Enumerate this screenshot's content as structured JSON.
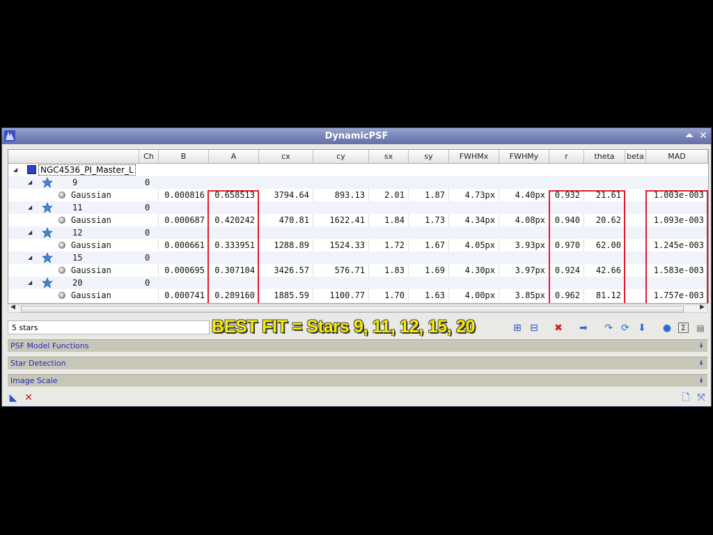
{
  "window": {
    "title": "DynamicPSF"
  },
  "table": {
    "columns": [
      "",
      "Ch",
      "B",
      "A",
      "cx",
      "cy",
      "sx",
      "sy",
      "FWHMx",
      "FWHMy",
      "r",
      "theta",
      "beta",
      "MAD"
    ],
    "root_label": "NGC4536_PI_Master_L",
    "stars": [
      {
        "id": "9",
        "ch": "0",
        "fn": "Gaussian",
        "B": "0.000816",
        "A": "0.658513",
        "cx": "3794.64",
        "cy": "893.13",
        "sx": "2.01",
        "sy": "1.87",
        "FWHMx": "4.73px",
        "FWHMy": "4.40px",
        "r": "0.932",
        "theta": "21.61",
        "beta": "",
        "MAD": "1.003e-003"
      },
      {
        "id": "11",
        "ch": "0",
        "fn": "Gaussian",
        "B": "0.000687",
        "A": "0.420242",
        "cx": "470.81",
        "cy": "1622.41",
        "sx": "1.84",
        "sy": "1.73",
        "FWHMx": "4.34px",
        "FWHMy": "4.08px",
        "r": "0.940",
        "theta": "20.62",
        "beta": "",
        "MAD": "1.093e-003"
      },
      {
        "id": "12",
        "ch": "0",
        "fn": "Gaussian",
        "B": "0.000661",
        "A": "0.333951",
        "cx": "1288.89",
        "cy": "1524.33",
        "sx": "1.72",
        "sy": "1.67",
        "FWHMx": "4.05px",
        "FWHMy": "3.93px",
        "r": "0.970",
        "theta": "62.00",
        "beta": "",
        "MAD": "1.245e-003"
      },
      {
        "id": "15",
        "ch": "0",
        "fn": "Gaussian",
        "B": "0.000695",
        "A": "0.307104",
        "cx": "3426.57",
        "cy": "576.71",
        "sx": "1.83",
        "sy": "1.69",
        "FWHMx": "4.30px",
        "FWHMy": "3.97px",
        "r": "0.924",
        "theta": "42.66",
        "beta": "",
        "MAD": "1.583e-003"
      },
      {
        "id": "20",
        "ch": "0",
        "fn": "Gaussian",
        "B": "0.000741",
        "A": "0.289160",
        "cx": "1885.59",
        "cy": "1100.77",
        "sx": "1.70",
        "sy": "1.63",
        "FWHMx": "4.00px",
        "FWHMy": "3.85px",
        "r": "0.962",
        "theta": "81.12",
        "beta": "",
        "MAD": "1.757e-003"
      }
    ]
  },
  "status": {
    "count": "5 stars"
  },
  "overlay_text": "BEST FIT = Stars 9, 11, 12, 15, 20",
  "sections": [
    {
      "label": "PSF Model Functions"
    },
    {
      "label": "Star Detection"
    },
    {
      "label": "Image Scale"
    }
  ],
  "colors": {
    "accent": "#1b2ec2",
    "highlight": "#e0182b",
    "overlay": "#f6ec00"
  },
  "icons": {
    "toolbar": [
      "expand-all-icon",
      "collapse-all-icon",
      "delete-icon",
      "forward-icon",
      "recalculate-icon",
      "refresh-icon",
      "download-icon",
      "average-icon",
      "sum-icon",
      "export-table-icon"
    ],
    "bottom": [
      "new-instance-icon",
      "reset-icon",
      "document-icon",
      "fit-icon"
    ]
  }
}
